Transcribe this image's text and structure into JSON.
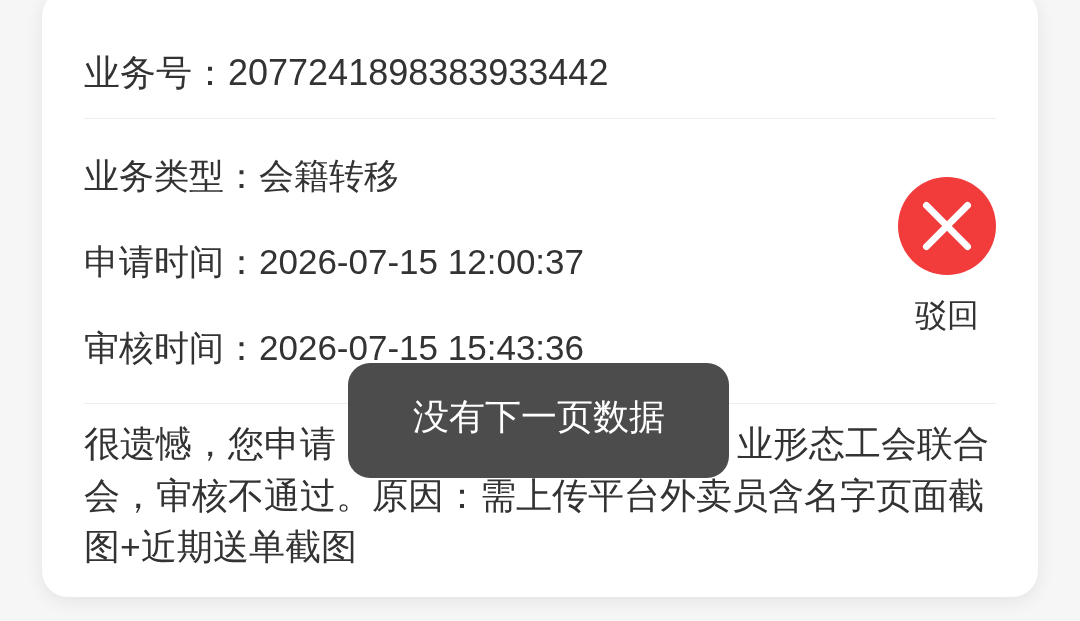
{
  "record": {
    "business_no": {
      "label": "业务号：",
      "value": "2077241898383933442"
    },
    "fields": [
      {
        "label": "业务类型：",
        "value": "会籍转移"
      },
      {
        "label": "申请时间：",
        "value": "2026-07-15 12:00:37"
      },
      {
        "label": "审核时间：",
        "value": "2026-07-15 15:43:36"
      }
    ],
    "status": {
      "kind": "rejected",
      "label": "驳回"
    },
    "message": {
      "before_toast": "很遗憾，您申请",
      "after_toast_line": "业形态工会联合",
      "continuation": "会，审核不通过。原因：需上传平台外卖员含名字页面截图+近期送单截图"
    }
  },
  "toast": {
    "text": "没有下一页数据"
  }
}
